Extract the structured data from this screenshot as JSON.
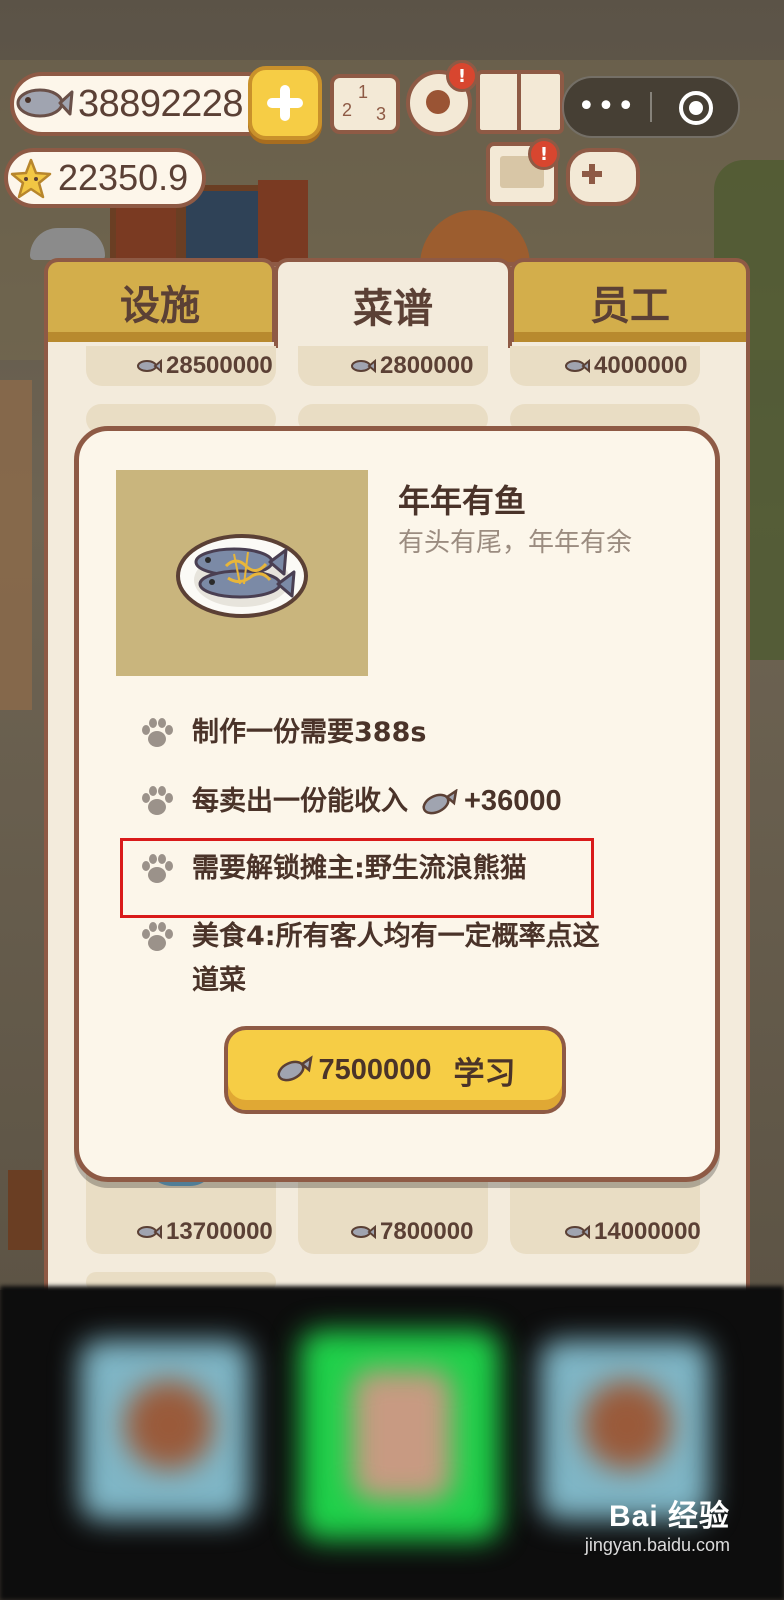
{
  "hud": {
    "fish_coins": "38892228",
    "stars": "22350.9",
    "rank_digits": [
      "2",
      "1",
      "3"
    ],
    "alert_mark": "!",
    "more_glyph": "•••"
  },
  "tabs": [
    {
      "label": "设施",
      "active": false
    },
    {
      "label": "菜谱",
      "active": true
    },
    {
      "label": "员工",
      "active": false
    }
  ],
  "recipe_grid": {
    "top_prices": [
      "28500000",
      "2800000",
      "4000000"
    ],
    "bottom_prices": [
      "13700000",
      "7800000",
      "14000000"
    ]
  },
  "popup": {
    "dish_name": "年年有鱼",
    "dish_desc": "有头有尾，年年有余",
    "info_rows": [
      {
        "text": "制作一份需要388s"
      },
      {
        "text": "每卖出一份能收入",
        "income": "+36000"
      },
      {
        "text": "需要解锁摊主:野生流浪熊猫",
        "highlighted": true
      },
      {
        "text": "美食4:所有客人均有一定概率点这道菜"
      }
    ],
    "learn_button": {
      "cost": "7500000",
      "label": "学习"
    }
  },
  "watermark": {
    "logo": "Bai 经验",
    "url": "jingyan.baidu.com"
  },
  "colors": {
    "accent_yellow": "#f6cd45",
    "brown_border": "#8e5a45",
    "highlight_red": "#d91a1a",
    "dish_bg": "#c9b57d"
  }
}
